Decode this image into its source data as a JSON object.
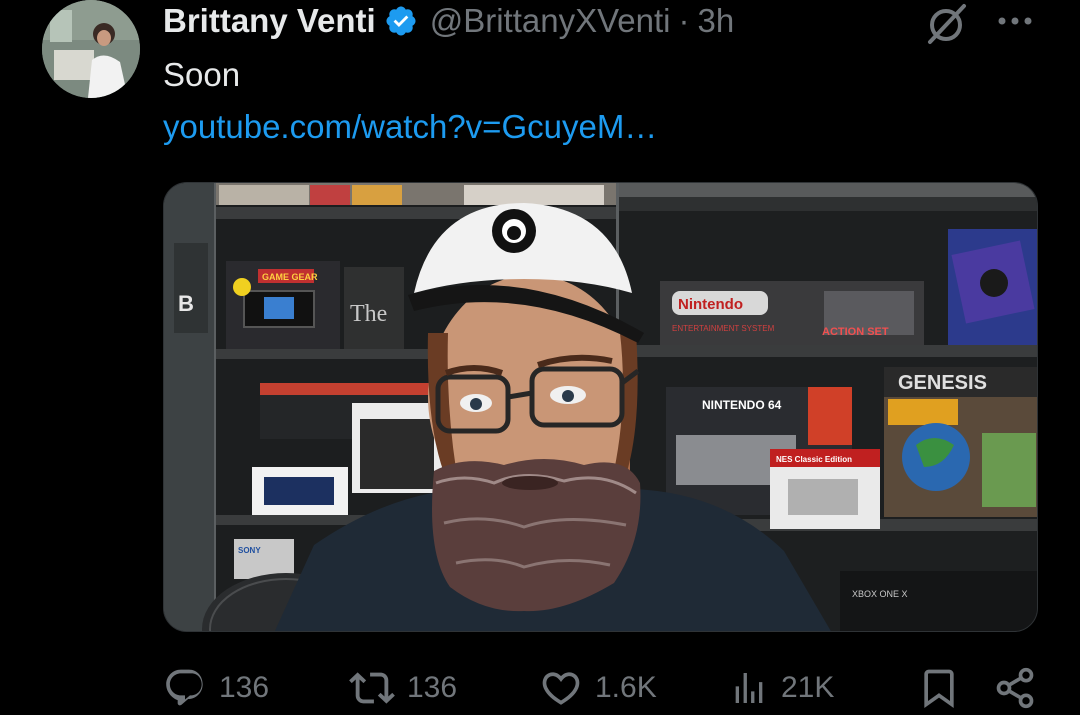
{
  "tweet": {
    "author": {
      "display_name": "Brittany Venti",
      "handle": "@BrittanyXVenti",
      "verified": true
    },
    "time_separator": "·",
    "timestamp": "3h",
    "text": "Soon",
    "link": "youtube.com/watch?v=GcuyeM…"
  },
  "media": {
    "sign_b": "B",
    "sign_the": "The",
    "game_gear_label": "GAME GEAR",
    "nintendo_label": "Nintendo",
    "nes_sub_label": "ENTERTAINMENT SYSTEM",
    "action_set_label": "ACTION SET",
    "genesis_label": "GENESIS",
    "n64_label": "NINTENDO 64",
    "nes_classic_label": "NES Classic Edition",
    "xbox_label": "XBOX ONE X",
    "sony_label": "SONY"
  },
  "actions": {
    "replies": "136",
    "reposts": "136",
    "likes": "1.6K",
    "views": "21K"
  },
  "colors": {
    "background": "#000000",
    "text": "#e7e9ea",
    "secondary": "#71767b",
    "link": "#1d9bf0",
    "verified": "#1d9bf0"
  },
  "icons": {
    "verified": "verified-badge-icon",
    "grok": "grok-icon",
    "more": "more-icon",
    "reply": "reply-icon",
    "repost": "repost-icon",
    "like": "heart-icon",
    "views": "views-icon",
    "bookmark": "bookmark-icon",
    "share": "share-icon"
  }
}
